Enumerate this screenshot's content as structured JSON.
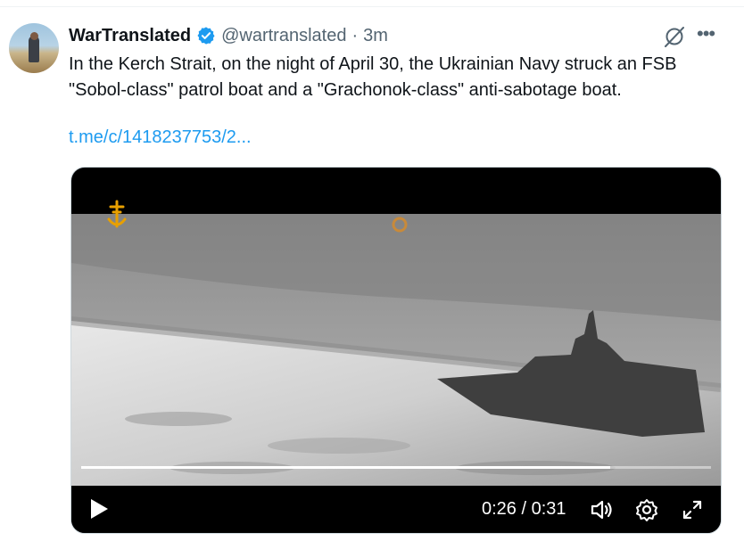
{
  "tweet": {
    "author_name": "WarTranslated",
    "handle": "@wartranslated",
    "separator": "·",
    "time": "3m",
    "text": "In the Kerch Strait, on the night of April 30, the Ukrainian Navy struck an FSB \"Sobol-class\" patrol boat and a \"Grachonok-class\" anti-sabotage boat.",
    "link": "t.me/c/1418237753/2...",
    "more_label": "•••"
  },
  "video": {
    "current_time": "0:26",
    "duration": "0:31",
    "time_separator": " / ",
    "progress": 0.84
  },
  "colors": {
    "link": "#1d9bf0",
    "verified": "#1d9bf0",
    "secondary_text": "#536471",
    "watermark": "#e8a000"
  },
  "icons": [
    "verified-badge-icon",
    "grok-icon",
    "more-icon",
    "play-icon",
    "volume-icon",
    "settings-icon",
    "fullscreen-icon",
    "navy-emblem-icon"
  ]
}
